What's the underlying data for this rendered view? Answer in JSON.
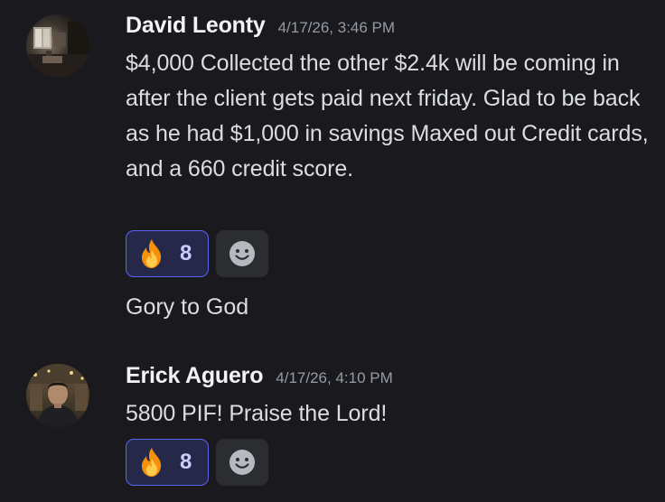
{
  "messages": [
    {
      "author": "David Leonty",
      "timestamp": "4/17/26, 3:46 PM",
      "text": "$4,000 Collected the other $2.4k will be coming in after the client gets paid next friday. Glad to be back as he had $1,000 in savings Maxed out Credit cards, and a 660 credit score.",
      "reaction": {
        "emoji": "fire-emoji",
        "count": "8"
      },
      "avatar": "dark-room-photo"
    },
    {
      "author": "Erick Aguero",
      "timestamp": "4/17/26, 4:10 PM",
      "text": "5800 PIF! Praise the Lord!",
      "reaction": {
        "emoji": "fire-emoji",
        "count": "8"
      },
      "avatar": "man-portrait-photo"
    }
  ],
  "followup_message": {
    "text": "Gory to God"
  },
  "colors": {
    "background": "#1a1a1e",
    "username": "#f2f3f5",
    "timestamp": "#949ba4",
    "text": "#dbdee1",
    "reaction_bg": "#26284a",
    "reaction_border": "#5865f2",
    "reaction_count": "#c9cdfb",
    "add_reaction_bg": "#2b2d31"
  }
}
